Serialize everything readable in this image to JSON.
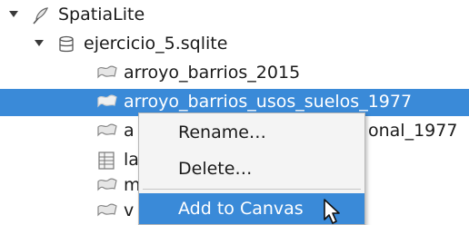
{
  "tree": {
    "root": {
      "label": "SpatiaLite",
      "icon": "feather-icon",
      "expanded": true
    },
    "database": {
      "label": "ejercicio_5.sqlite",
      "icon": "database-icon",
      "expanded": true
    },
    "layers": [
      {
        "label": "arroyo_barrios_2015",
        "icon": "polygon-layer-icon",
        "selected": false
      },
      {
        "label": "arroyo_barrios_usos_suelos_1977",
        "icon": "polygon-layer-icon",
        "selected": true
      },
      {
        "label": "a",
        "suffix": "onal_1977",
        "icon": "polygon-layer-icon",
        "selected": false
      },
      {
        "label": "la",
        "icon": "table-icon",
        "selected": false
      },
      {
        "label": "m",
        "icon": "polygon-layer-icon",
        "selected": false
      },
      {
        "label": "v",
        "icon": "polygon-layer-icon",
        "selected": false
      }
    ]
  },
  "context_menu": {
    "items": [
      {
        "label": "Rename…",
        "highlighted": false
      },
      {
        "label": "Delete…",
        "highlighted": false
      },
      {
        "label": "Add to Canvas",
        "highlighted": true
      }
    ]
  },
  "colors": {
    "selection": "#3a8ad8",
    "text": "#1a1a1a"
  }
}
